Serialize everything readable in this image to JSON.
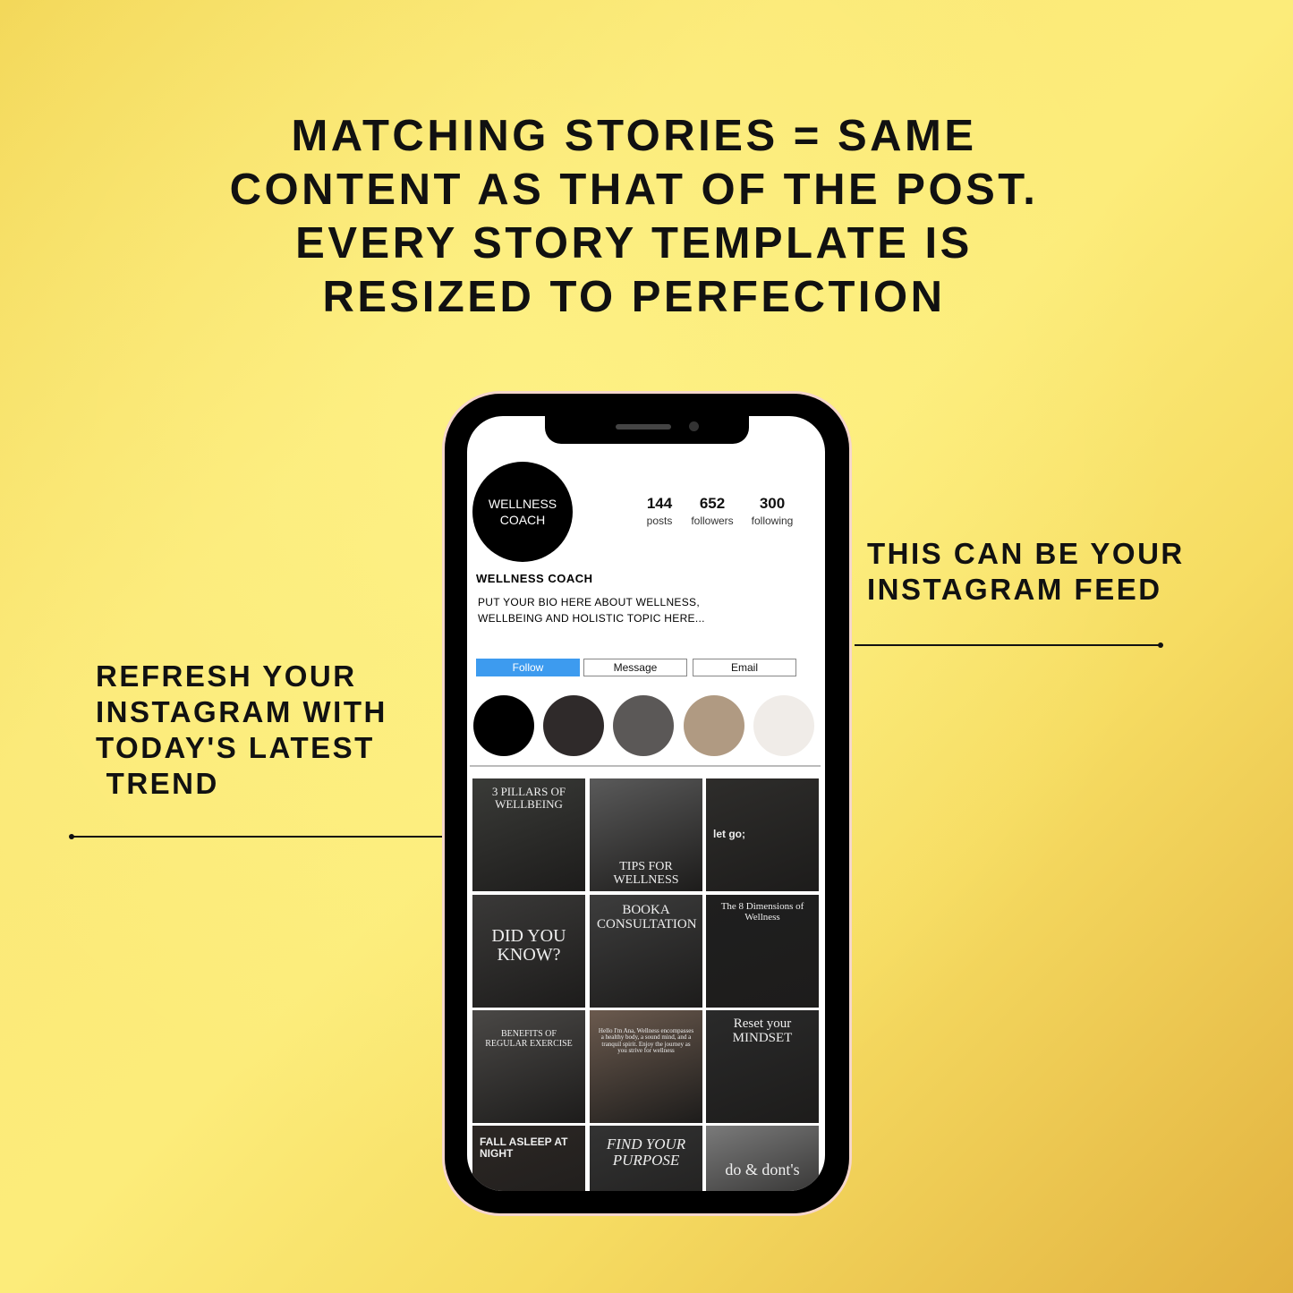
{
  "headline": [
    "MATCHING STORIES = SAME",
    "CONTENT AS THAT OF THE POST.",
    "EVERY STORY TEMPLATE IS",
    "RESIZED TO PERFECTION"
  ],
  "right_callout": "THIS CAN BE YOUR\nINSTAGRAM FEED",
  "left_callout": "REFRESH YOUR\nINSTAGRAM WITH\nTODAY'S LATEST\n TREND",
  "profile": {
    "avatar_text": [
      "WELLNESS",
      "COACH"
    ],
    "stats": [
      {
        "value": "144",
        "label": "posts"
      },
      {
        "value": "652",
        "label": "followers"
      },
      {
        "value": "300",
        "label": "following"
      }
    ],
    "name": "WELLNESS COACH",
    "bio": [
      "PUT YOUR BIO HERE ABOUT WELLNESS,",
      "WELLBEING AND HOLISTIC TOPIC HERE..."
    ],
    "buttons": {
      "follow": "Follow",
      "message": "Message",
      "email": "Email"
    },
    "follow_color": "#3d9bef"
  },
  "palette": [
    "#000000",
    "#2f2a2a",
    "#5b5857",
    "#b09a82",
    "#f0ece8"
  ],
  "tiles": [
    {
      "title": "3 PILLARS OF WELLBEING",
      "bg": "#3a3b38"
    },
    {
      "title": "TIPS FOR WELLNESS",
      "bg": "#5a5a5a"
    },
    {
      "title": "let go;",
      "bg": "#2e2d2b"
    },
    {
      "title": "DID YOU KNOW?",
      "bg": "#3a3938"
    },
    {
      "title": "BOOKA CONSULTATION",
      "bg": "#3d3d3d"
    },
    {
      "title": "The 8 Dimensions of Wellness",
      "bg": "#1f1f1f"
    },
    {
      "title": "BENEFITS OF REGULAR EXERCISE",
      "bg": "#4a4846"
    },
    {
      "title": "Hello I'm Ana, Wellness encompasses a healthy body, a sound mind, and a tranquil spirit. Enjoy the journey as you strive for wellness",
      "bg": "#6b5a4e"
    },
    {
      "title": "Reset your MINDSET",
      "bg": "#2a2a2a"
    },
    {
      "title": "FALL ASLEEP AT NIGHT",
      "bg": "#2c2724"
    },
    {
      "title": "FIND YOUR PURPOSE",
      "bg": "#333333"
    },
    {
      "title": "do & dont's",
      "bg": "#7a7a7a"
    }
  ]
}
